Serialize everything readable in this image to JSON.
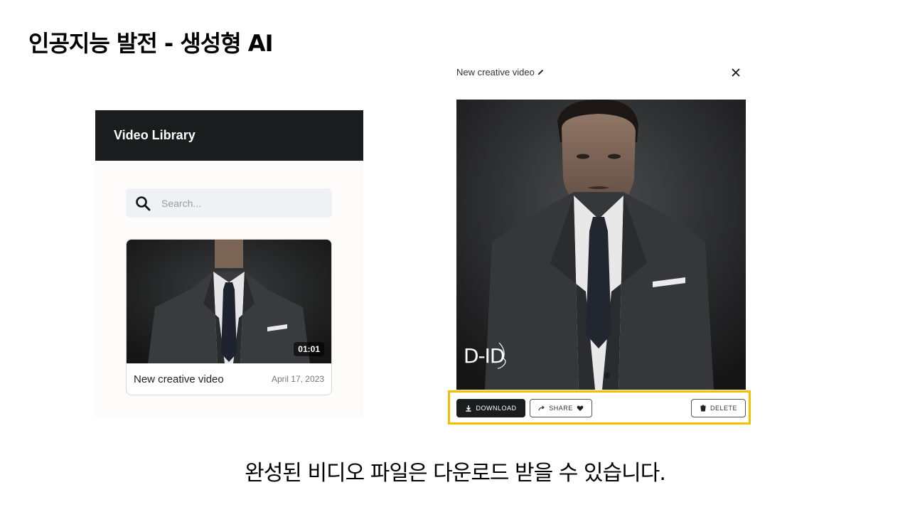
{
  "slide": {
    "title": "인공지능 발전 - 생성형 AI",
    "caption": "완성된 비디오 파일은 다운로드 받을 수 있습니다."
  },
  "library": {
    "header": "Video Library",
    "search_placeholder": "Search...",
    "card": {
      "title": "New creative video",
      "date": "April 17, 2023",
      "duration": "01:01"
    }
  },
  "preview": {
    "title": "New creative video",
    "watermark": "D-ID",
    "actions": {
      "download": "DOWNLOAD",
      "share": "SHARE",
      "delete": "DELETE"
    }
  },
  "colors": {
    "header_bg": "#1b1c1e",
    "highlight": "#f4bf00",
    "suit": "#2d2e31"
  },
  "icons": [
    "search-icon",
    "pencil-icon",
    "close-icon",
    "download-icon",
    "share-icon",
    "heart-icon",
    "trash-icon"
  ]
}
